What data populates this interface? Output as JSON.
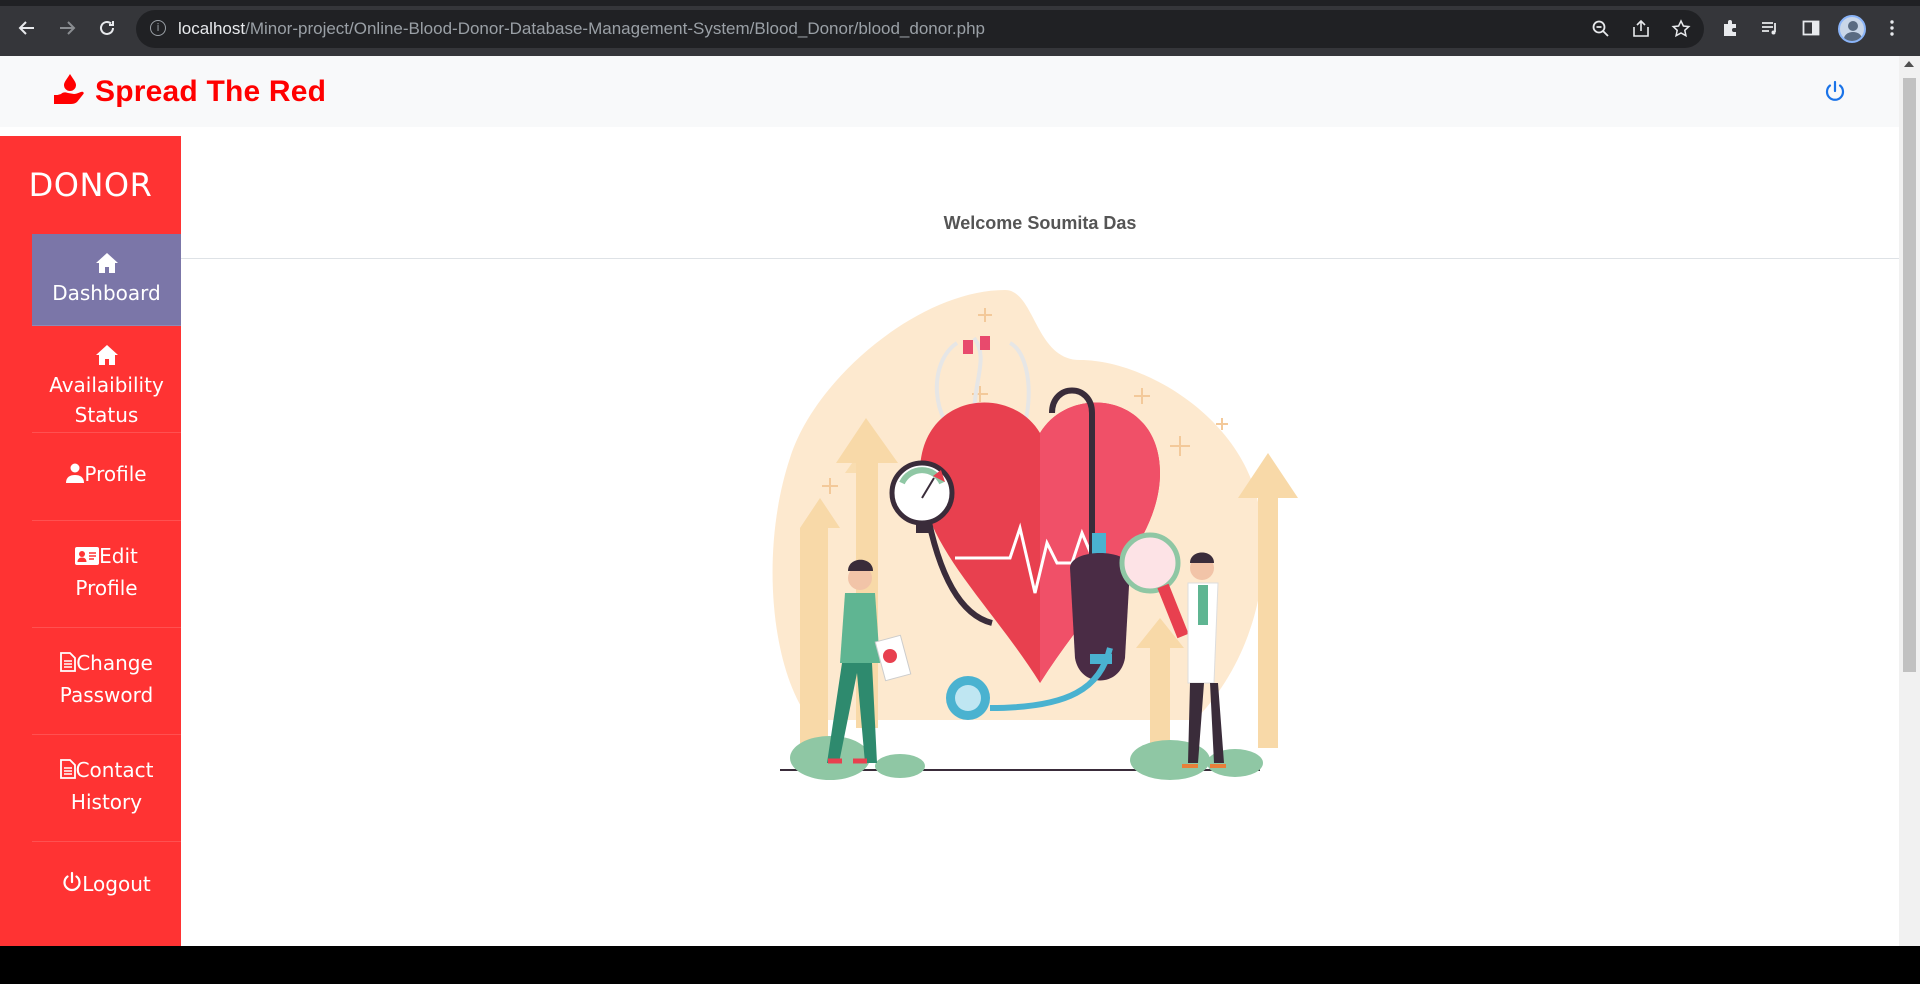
{
  "browser": {
    "url_host": "localhost",
    "url_path": "/Minor-project/Online-Blood-Donor-Database-Management-System/Blood_Donor/blood_donor.php"
  },
  "brand": {
    "name": "Spread The Red",
    "color": "#ff0000"
  },
  "sidebar": {
    "title": "DONOR",
    "bg_color": "#ff3333",
    "active_color": "#7b76a8",
    "items": [
      {
        "label": "Dashboard",
        "icon": "home-icon",
        "active": true
      },
      {
        "label_line1": "Availaibility",
        "label_line2": "Status",
        "icon": "home-icon"
      },
      {
        "label": "Profile",
        "icon": "user-icon"
      },
      {
        "label_line1": "Edit",
        "label_line2": "Profile",
        "icon": "id-card-icon"
      },
      {
        "label_line1": "Change",
        "label_line2": "Password",
        "icon": "file-icon"
      },
      {
        "label_line1": "Contact",
        "label_line2": "History",
        "icon": "file-icon"
      },
      {
        "label": "Logout",
        "icon": "power-icon"
      }
    ]
  },
  "main": {
    "welcome": "Welcome Soumita Das",
    "illustration": "heart-health-illustration"
  },
  "header": {
    "power_icon": "power-icon",
    "power_color": "#1a73e8"
  }
}
